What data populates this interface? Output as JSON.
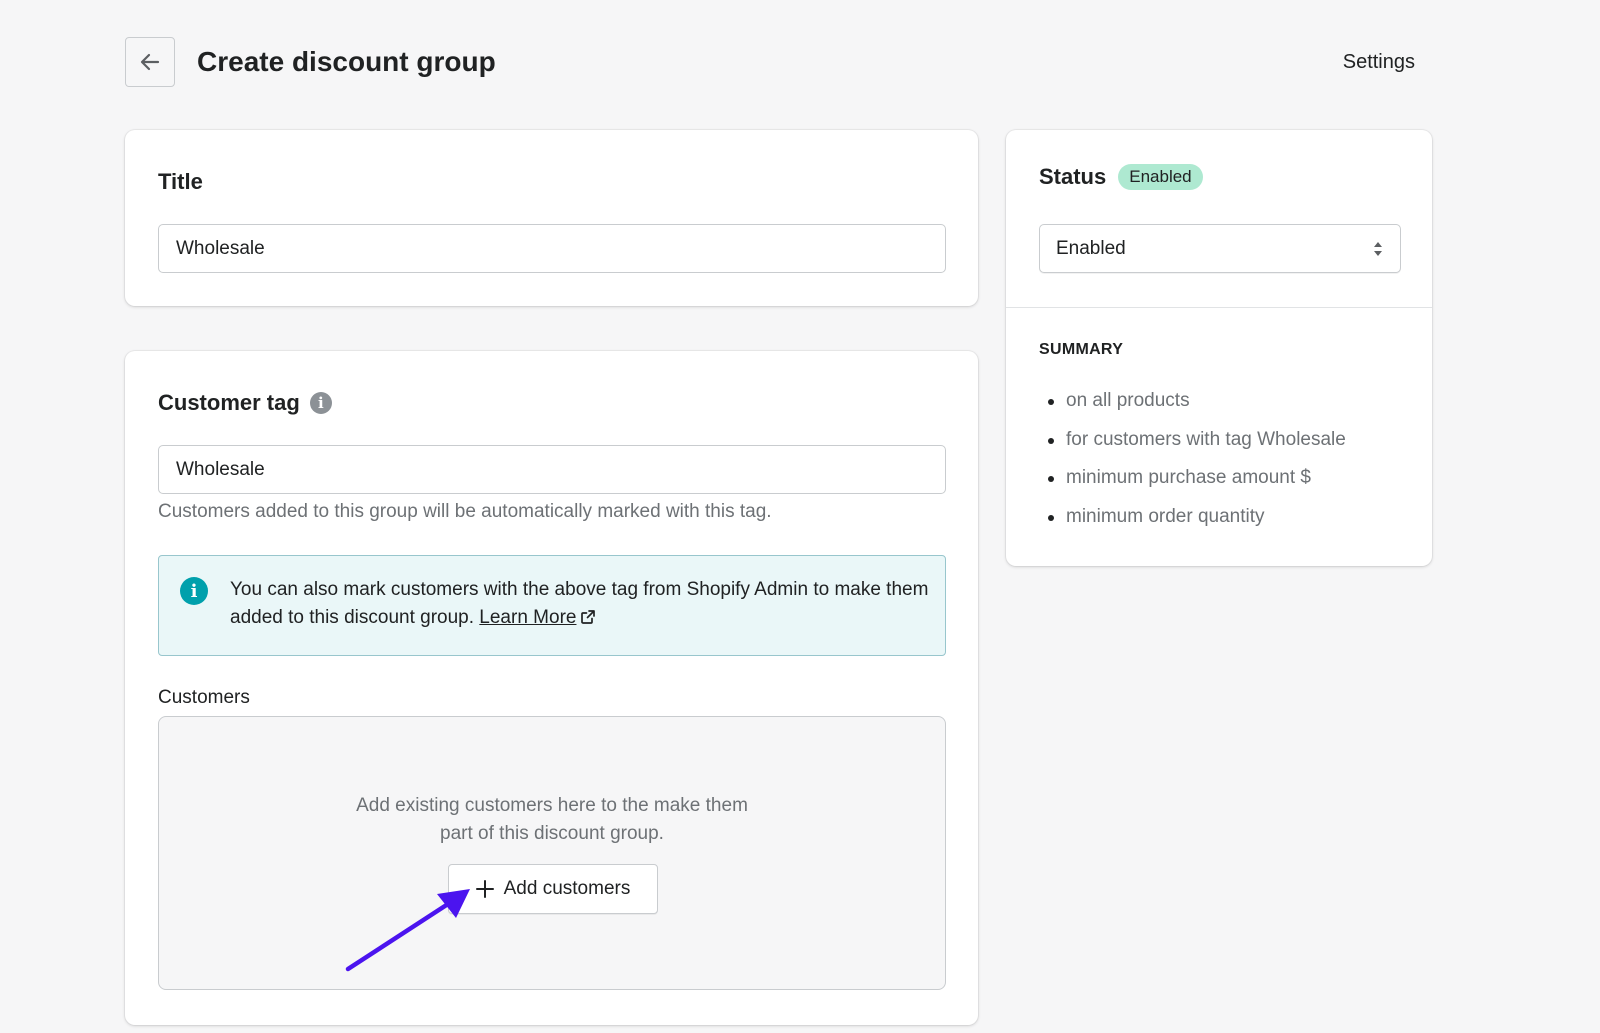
{
  "header": {
    "title": "Create discount group",
    "settings_label": "Settings"
  },
  "title_card": {
    "heading": "Title",
    "input_value": "Wholesale"
  },
  "tag_card": {
    "heading": "Customer tag",
    "input_value": "Wholesale",
    "help_text": "Customers added to this group will be automatically marked with this tag.",
    "banner": {
      "text": "You can also mark customers with the above tag from Shopify Admin to make them added to this discount group.",
      "link_label": "Learn More"
    },
    "customers_label": "Customers",
    "empty_text": "Add existing customers here to the make them part of this discount group.",
    "add_button_label": "Add customers"
  },
  "status_card": {
    "heading": "Status",
    "badge": "Enabled",
    "select_value": "Enabled",
    "summary_heading": "SUMMARY",
    "summary_items": [
      "on all products",
      "for customers with tag Wholesale",
      "minimum purchase amount $",
      "minimum order quantity"
    ]
  },
  "colors": {
    "background": "#f6f6f7",
    "badge_success": "#aee9d1",
    "info_banner_bg": "#eaf7f8",
    "info_icon": "#00a0ac",
    "annotation_arrow": "#4b14ef"
  },
  "icons": {
    "back": "arrow-left-icon",
    "tag_info": "info-icon",
    "banner_info": "info-icon",
    "external_link": "external-link-icon",
    "add": "plus-icon",
    "select": "select-arrows-icon"
  }
}
